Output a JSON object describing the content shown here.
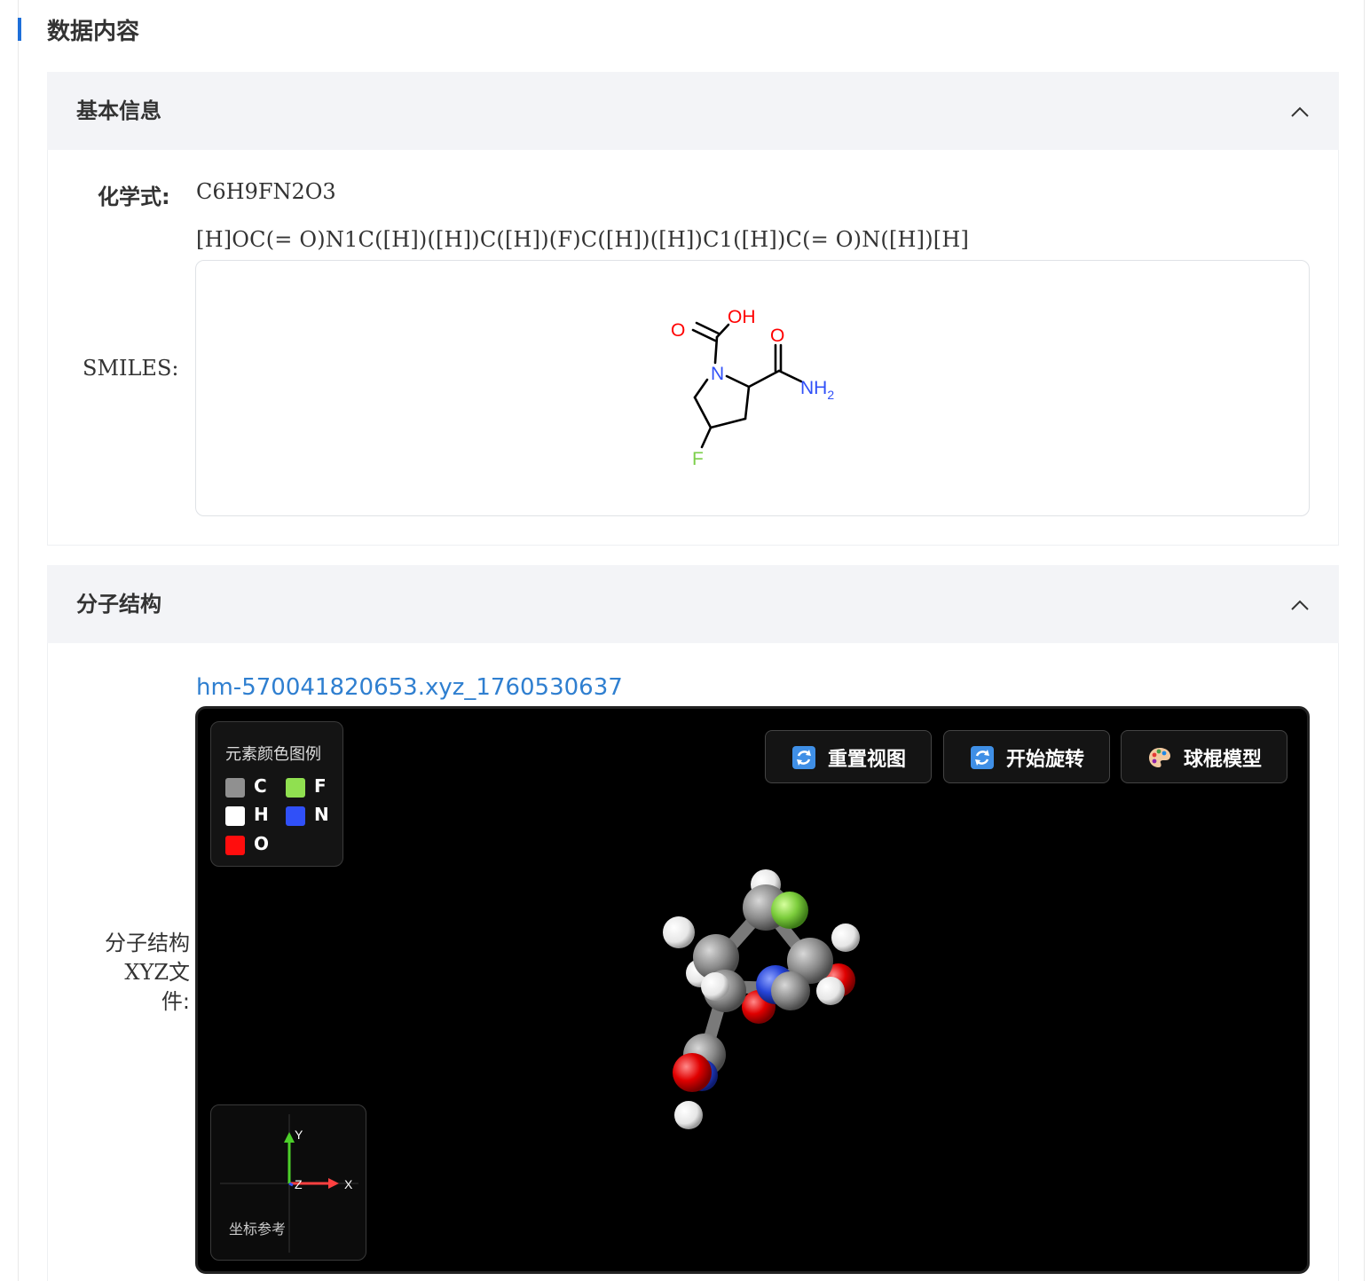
{
  "page": {
    "title": "数据内容"
  },
  "basic_info": {
    "header": "基本信息",
    "formula_label": "化学式:",
    "formula_value": "C6H9FN2O3",
    "smiles_label": "SMILES:",
    "smiles_value": "[H]OC(= O)N1C([H])([H])C([H])(F)C([H])([H])C1([H])C(= O)N([H])[H]",
    "structure_atoms": {
      "o1": "O",
      "oh": "OH",
      "o2": "O",
      "n": "N",
      "nh2": "NH",
      "nh2_sub": "2",
      "f": "F"
    }
  },
  "molecule_structure": {
    "header": "分子结构",
    "xyz_label_line1": "分子结构",
    "xyz_label_line2": "XYZ文",
    "xyz_label_line3": "件:",
    "xyz_file": "hm-570041820653.xyz_1760530637",
    "legend": {
      "title": "元素颜色图例",
      "items": [
        {
          "symbol": "C",
          "color": "#909090"
        },
        {
          "symbol": "F",
          "color": "#90e050"
        },
        {
          "symbol": "H",
          "color": "#ffffff"
        },
        {
          "symbol": "N",
          "color": "#3050f8"
        },
        {
          "symbol": "O",
          "color": "#ff0d0d"
        }
      ]
    },
    "buttons": {
      "reset": "重置视图",
      "rotate": "开始旋转",
      "model": "球棍模型"
    },
    "axes": {
      "x": "X",
      "y": "Y",
      "z": "Z",
      "caption": "坐标参考"
    }
  }
}
